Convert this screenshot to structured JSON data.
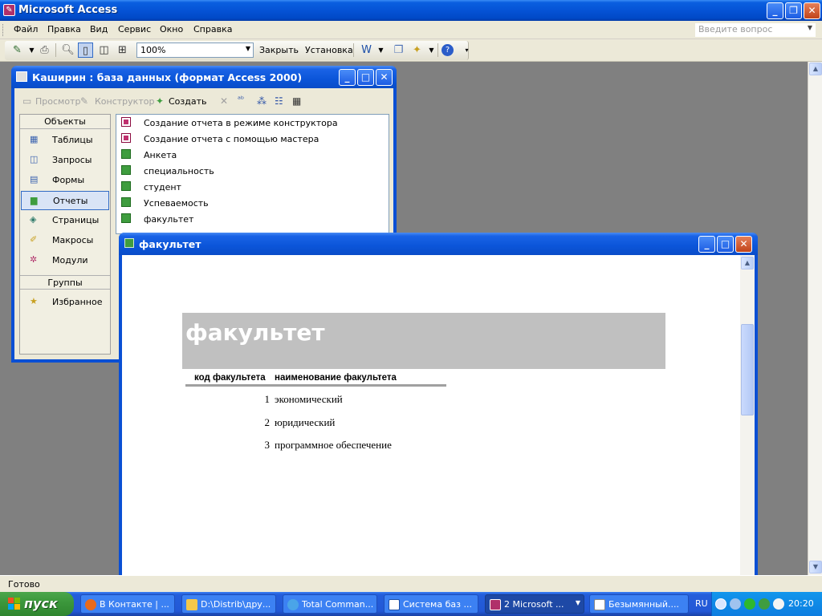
{
  "app": {
    "title": "Microsoft Access"
  },
  "menu": {
    "items": [
      "Файл",
      "Правка",
      "Вид",
      "Сервис",
      "Окно",
      "Справка"
    ],
    "help_placeholder": "Введите вопрос"
  },
  "toolbar": {
    "zoom": "100%",
    "close_label": "Закрыть",
    "setup_label": "Установка"
  },
  "db_window": {
    "title": "Каширин : база данных (формат Access 2000)",
    "toolbar": {
      "preview": "Просмотр",
      "design": "Конструктор",
      "create": "Создать"
    },
    "objects_header": "Объекты",
    "objects": [
      {
        "label": "Таблицы",
        "icon": "table-icon"
      },
      {
        "label": "Запросы",
        "icon": "query-icon"
      },
      {
        "label": "Формы",
        "icon": "form-icon"
      },
      {
        "label": "Отчеты",
        "icon": "report-icon",
        "selected": true
      },
      {
        "label": "Страницы",
        "icon": "page-icon"
      },
      {
        "label": "Макросы",
        "icon": "macro-icon"
      },
      {
        "label": "Модули",
        "icon": "module-icon"
      }
    ],
    "groups_header": "Группы",
    "groups": [
      {
        "label": "Избранное",
        "icon": "favorites-folder-icon"
      }
    ],
    "list": [
      {
        "label": "Создание отчета в режиме конструктора",
        "icon": "wizard-icon"
      },
      {
        "label": "Создание отчета с помощью мастера",
        "icon": "wizard-icon"
      },
      {
        "label": "Анкета",
        "icon": "report-icon"
      },
      {
        "label": "специальность",
        "icon": "report-icon"
      },
      {
        "label": "студент",
        "icon": "report-icon"
      },
      {
        "label": "Успеваемость",
        "icon": "report-icon"
      },
      {
        "label": "факультет",
        "icon": "report-icon"
      }
    ]
  },
  "report_window": {
    "title": "факультет",
    "heading": "факультет",
    "columns": [
      "код факультета",
      "наименование факультета"
    ],
    "rows": [
      {
        "code": "1",
        "name": "экономический"
      },
      {
        "code": "2",
        "name": "юридический"
      },
      {
        "code": "3",
        "name": "программное обеспечение"
      }
    ]
  },
  "status": {
    "text": "Готово"
  },
  "taskbar": {
    "start": "пуск",
    "buttons": [
      {
        "label": "В Контакте | ...",
        "color": "#e86a1c"
      },
      {
        "label": "D:\\Distrib\\дру...",
        "color": "#f4c84a"
      },
      {
        "label": "Total Comman...",
        "color": "#4aa4e8"
      },
      {
        "label": "Система баз ...",
        "color": "#ffffff"
      },
      {
        "label": "2 Microsoft ...",
        "color": "#b0306a",
        "active": true
      },
      {
        "label": "Безымянный....",
        "color": "#ffffff"
      }
    ],
    "lang": "RU",
    "clock": "20:20"
  }
}
